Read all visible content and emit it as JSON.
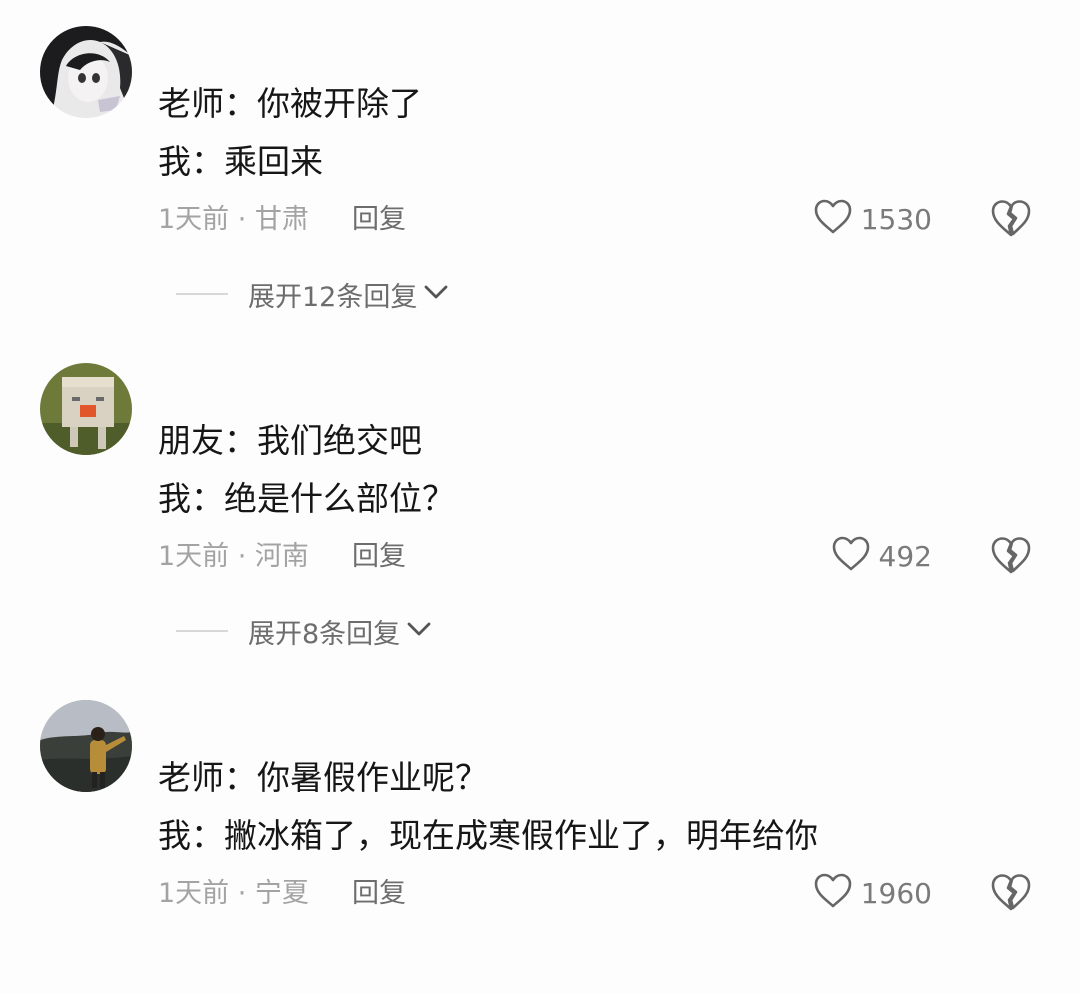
{
  "comments": [
    {
      "line1": "老师：你被开除了",
      "line2": "我：乘回来",
      "meta": "1天前 · 甘肃",
      "reply_label": "回复",
      "likes": "1530",
      "expand_label": "展开12条回复"
    },
    {
      "line1": "朋友：我们绝交吧",
      "line2": "我：绝是什么部位？",
      "meta": "1天前 · 河南",
      "reply_label": "回复",
      "likes": "492",
      "expand_label": "展开8条回复"
    },
    {
      "line1": "老师：你暑假作业呢？",
      "line2": "我：撇冰箱了，现在成寒假作业了，明年给你",
      "meta": "1天前 · 宁夏",
      "reply_label": "回复",
      "likes": "1960"
    }
  ],
  "icons": {
    "like": "heart-outline-icon",
    "dislike": "broken-heart-icon",
    "expand": "chevron-down-icon"
  },
  "colors": {
    "text": "#161616",
    "meta": "#a3a3a3",
    "secondary": "#6d6d6d",
    "background": "#fdfdfd"
  }
}
